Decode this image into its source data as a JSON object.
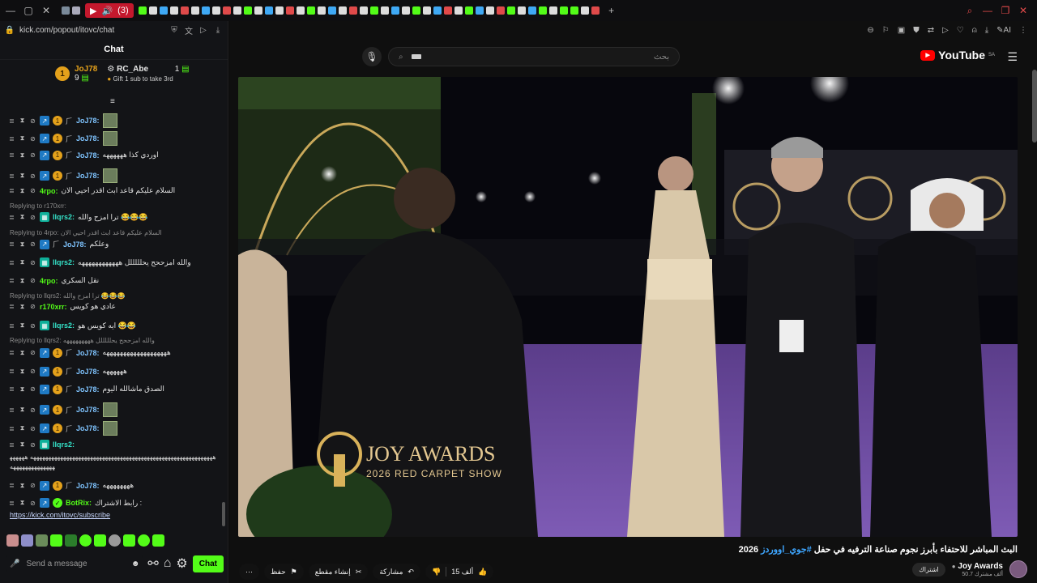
{
  "browser": {
    "audio_tab_count": "(3)"
  },
  "chat": {
    "url": "kick.com/popout/itovc/chat",
    "header": "Chat",
    "leaderboard": {
      "first": {
        "rank": "1",
        "name": "JoJ78",
        "count": "9"
      },
      "second": {
        "name": "RC_Abe",
        "count": "1",
        "note": "Gift 1 sub to take 3rd"
      }
    },
    "messages": [
      {
        "user": "JoJ78:",
        "text": ""
      },
      {
        "user": "JoJ78:",
        "text": ""
      },
      {
        "user": "JoJ78:",
        "text": "اوردي كذا ههههههه"
      },
      {
        "user": "JoJ78:",
        "text": ""
      },
      {
        "user": "4rpo:",
        "text": "السلام عليكم قاعد ابث اقدر احيي الان"
      },
      {
        "reply": "Replying to r170xrr:",
        "user": "llqrs2:",
        "text": "ترا امزح والله 😂😂😂"
      },
      {
        "reply": "Replying to 4rpo: السلام عليكم قاعد ابث اقدر احيي الان",
        "user": "JoJ78:",
        "text": "وعلكم"
      },
      {
        "user": "llqrs2:",
        "text": "والله امزححح يحلللللل ههههههههههههه"
      },
      {
        "user": "4rpo:",
        "text": "نقل السكري"
      },
      {
        "reply": "Replying to llqrs2: ترا امزح والله 😂😂😂",
        "user": "r170xrr:",
        "text": "عادي هو كويس"
      },
      {
        "user": "llqrs2:",
        "text": "ايه كويس هو 😂😂"
      },
      {
        "reply": "Replying to llqrs2: والله امزححح يحلللللل هههههههههه",
        "user": "JoJ78:",
        "text": "هههههههههههههههههههه"
      },
      {
        "user": "JoJ78:",
        "text": "ههههههه"
      },
      {
        "user": "JoJ78:",
        "text": "الصدق ماشالله اليوم"
      },
      {
        "user": "JoJ78:",
        "text": ""
      },
      {
        "user": "JoJ78:",
        "text": ""
      },
      {
        "user": "llqrs2:",
        "text": ""
      },
      {
        "long": "هههههههههههههههههههههههههههههههههههههههههههههههههههههههههههههه ههههههههههههههههههههه"
      },
      {
        "user": "JoJ78:",
        "text": "ههههههههه"
      },
      {
        "user": "BotRix:",
        "text": "رابط الاشتراك :",
        "link": "https://kick.com/itovc/subscribe"
      }
    ],
    "input_placeholder": "Send a message",
    "chat_button": "Chat"
  },
  "youtube": {
    "search_placeholder": "بحث",
    "logo_text": "YouTube",
    "region": "SA",
    "video_overlay": {
      "line1": "JOY AWARDS",
      "line2": "2026 RED CARPET SHOW"
    },
    "title_prefix": "البث المباشر للاحتفاء بأبرز نجوم صناعة الترفيه في حفل ",
    "title_hashtag": "#جوي_اووردز",
    "title_suffix": " 2026",
    "actions": {
      "save": "حفظ",
      "clip": "إنشاء مقطع",
      "share": "مشاركة",
      "likes": "15 ألف"
    },
    "channel": {
      "name": "Joy Awards",
      "subs": "50.7 ألف مشترك",
      "subscribe": "اشتراك"
    }
  },
  "colors": {
    "kick_green": "#53fc18",
    "gold": "#e4a11b",
    "youtube_red": "#ff0000",
    "carpet_purple": "#7a4fb0"
  }
}
